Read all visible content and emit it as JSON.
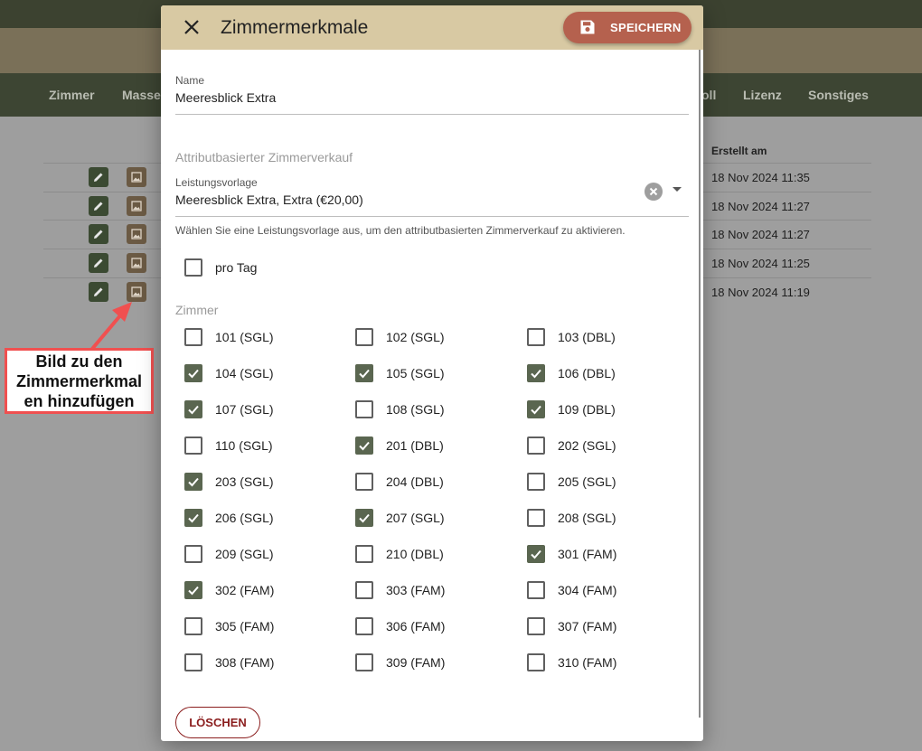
{
  "background": {
    "nav": [
      "Zimmer",
      "Masse",
      "oll",
      "Lizenz",
      "Sonstiges"
    ],
    "table": {
      "header_created": "Erstellt am",
      "rows": [
        {
          "created": "18 Nov 2024 11:35"
        },
        {
          "created": "18 Nov 2024 11:27"
        },
        {
          "created": "18 Nov 2024 11:27"
        },
        {
          "created": "18 Nov 2024 11:25"
        },
        {
          "created": "18 Nov 2024 11:19"
        }
      ]
    }
  },
  "annotation": {
    "callout_text": "Bild zu den Zimmermerkmal en hinzufügen",
    "color": "#f05050"
  },
  "dialog": {
    "title": "Zimmermerkmale",
    "save_label": "SPEICHERN",
    "name_label": "Name",
    "name_value": "Meeresblick Extra",
    "section_attr": "Attributbasierter Zimmerverkauf",
    "template_label": "Leistungsvorlage",
    "template_value": "Meeresblick Extra, Extra (€20,00)",
    "template_hint": "Wählen Sie eine Leistungsvorlage aus, um den attributbasierten Zimmerverkauf zu aktivieren.",
    "per_day_label": "pro Tag",
    "per_day_checked": false,
    "rooms_section": "Zimmer",
    "rooms": [
      {
        "label": "101 (SGL)",
        "checked": false
      },
      {
        "label": "102 (SGL)",
        "checked": false
      },
      {
        "label": "103 (DBL)",
        "checked": false
      },
      {
        "label": "104 (SGL)",
        "checked": true
      },
      {
        "label": "105 (SGL)",
        "checked": true
      },
      {
        "label": "106 (DBL)",
        "checked": true
      },
      {
        "label": "107 (SGL)",
        "checked": true
      },
      {
        "label": "108 (SGL)",
        "checked": false
      },
      {
        "label": "109 (DBL)",
        "checked": true
      },
      {
        "label": "110 (SGL)",
        "checked": false
      },
      {
        "label": "201 (DBL)",
        "checked": true
      },
      {
        "label": "202 (SGL)",
        "checked": false
      },
      {
        "label": "203 (SGL)",
        "checked": true
      },
      {
        "label": "204 (DBL)",
        "checked": false
      },
      {
        "label": "205 (SGL)",
        "checked": false
      },
      {
        "label": "206 (SGL)",
        "checked": true
      },
      {
        "label": "207 (SGL)",
        "checked": true
      },
      {
        "label": "208 (SGL)",
        "checked": false
      },
      {
        "label": "209 (SGL)",
        "checked": false
      },
      {
        "label": "210 (DBL)",
        "checked": false
      },
      {
        "label": "301 (FAM)",
        "checked": true
      },
      {
        "label": "302 (FAM)",
        "checked": true
      },
      {
        "label": "303 (FAM)",
        "checked": false
      },
      {
        "label": "304 (FAM)",
        "checked": false
      },
      {
        "label": "305 (FAM)",
        "checked": false
      },
      {
        "label": "306 (FAM)",
        "checked": false
      },
      {
        "label": "307 (FAM)",
        "checked": false
      },
      {
        "label": "308 (FAM)",
        "checked": false
      },
      {
        "label": "309 (FAM)",
        "checked": false
      },
      {
        "label": "310 (FAM)",
        "checked": false
      }
    ],
    "delete_label": "LÖSCHEN"
  },
  "colors": {
    "header_bg": "#d8c9a3",
    "save_button": "#b5614e",
    "checkbox_checked": "#5a6650",
    "delete_border": "#8b1e1e"
  }
}
